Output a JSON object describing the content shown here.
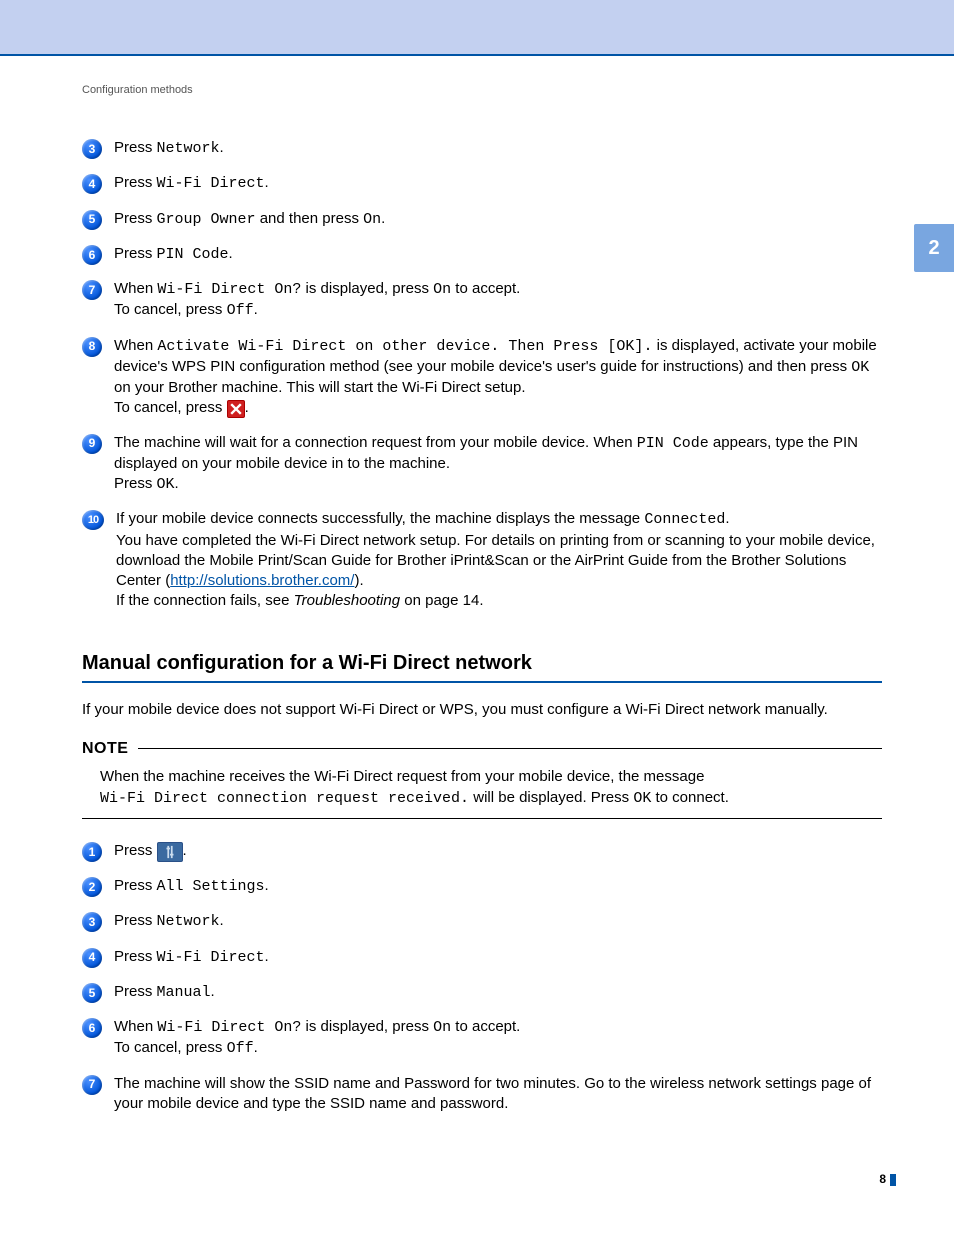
{
  "chapter_badge": "2",
  "breadcrumb": "Configuration methods",
  "page_number": "8",
  "partA": {
    "s3": {
      "pre": "Press ",
      "code": "Network",
      "post": "."
    },
    "s4": {
      "pre": "Press ",
      "code": "Wi-Fi Direct",
      "post": "."
    },
    "s5": {
      "pre": "Press ",
      "code1": "Group Owner",
      "mid": " and then press ",
      "code2": "On",
      "post": "."
    },
    "s6": {
      "pre": "Press ",
      "code": "PIN Code",
      "post": "."
    },
    "s7": {
      "pre": "When ",
      "code1": "Wi-Fi Direct On?",
      "mid1": " is displayed, press ",
      "code2": "On",
      "mid2": " to accept.",
      "line2a": "To cancel, press ",
      "code3": "Off",
      "line2b": "."
    },
    "s8": {
      "pre": "When ",
      "code1": "Activate Wi-Fi Direct on other device. Then Press [OK].",
      "mid1": " is displayed, activate your mobile device's WPS PIN configuration method (see your mobile device's user's guide for instructions) and then press ",
      "code2": "OK",
      "mid2": " on your Brother machine. This will start the Wi-Fi Direct setup.",
      "line2a": "To cancel, press ",
      "line2b": "."
    },
    "s9": {
      "pre": "The machine will wait for a connection request from your mobile device. When ",
      "code1": "PIN Code",
      "mid1": " appears, type the PIN displayed on your mobile device in to the machine.",
      "line2a": "Press ",
      "code2": "OK",
      "line2b": "."
    },
    "s10": {
      "pre": "If your mobile device connects successfully, the machine displays the message ",
      "code1": "Connected",
      "mid1": ".",
      "line2": "You have completed the Wi-Fi Direct network setup. For details on printing from or scanning to your mobile device, download the Mobile Print/Scan Guide for Brother iPrint&Scan or the AirPrint Guide from the Brother Solutions Center (",
      "url": "http://solutions.brother.com/",
      "line2b": ").",
      "line3a": "If the connection fails, see ",
      "line3_em": "Troubleshooting",
      "line3b": " on page 14."
    }
  },
  "section_title": "Manual configuration for a Wi-Fi Direct network",
  "section_intro": "If your mobile device does not support Wi-Fi Direct or WPS, you must configure a Wi-Fi Direct network manually.",
  "note": {
    "label": "NOTE",
    "line1": "When the machine receives the Wi-Fi Direct request from your mobile device, the message",
    "code": "Wi-Fi Direct connection request received.",
    "line2a": " will be displayed. Press ",
    "code2": "OK",
    "line2b": " to connect."
  },
  "partB": {
    "s1": {
      "pre": "Press ",
      "post": "."
    },
    "s2": {
      "pre": "Press ",
      "code": "All Settings",
      "post": "."
    },
    "s3": {
      "pre": "Press ",
      "code": "Network",
      "post": "."
    },
    "s4": {
      "pre": "Press ",
      "code": "Wi-Fi Direct",
      "post": "."
    },
    "s5": {
      "pre": "Press ",
      "code": "Manual",
      "post": "."
    },
    "s6": {
      "pre": "When ",
      "code1": "Wi-Fi Direct On?",
      "mid1": " is displayed, press ",
      "code2": "On",
      "mid2": " to accept.",
      "line2a": "To cancel, press ",
      "code3": "Off",
      "line2b": "."
    },
    "s7": {
      "text": "The machine will show the SSID name and Password for two minutes. Go to the wireless network settings page of your mobile device and type the SSID name and password."
    }
  }
}
